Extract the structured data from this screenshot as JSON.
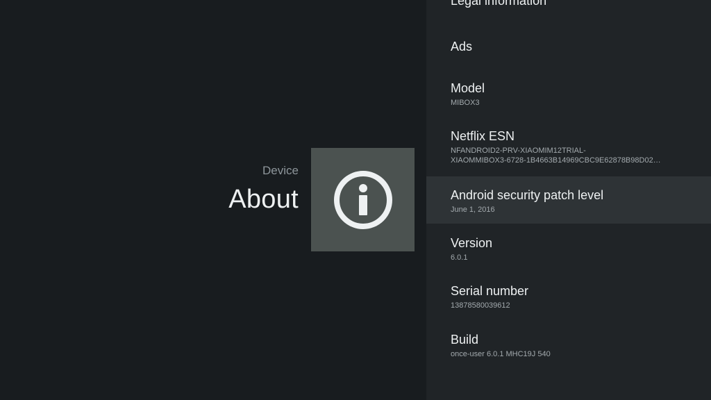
{
  "header": {
    "breadcrumb": "Device",
    "title": "About",
    "icon": "info-icon"
  },
  "items": [
    {
      "title": "Legal information",
      "summary": ""
    },
    {
      "title": "Ads",
      "summary": ""
    },
    {
      "title": "Model",
      "summary": "MIBOX3"
    },
    {
      "title": "Netflix ESN",
      "summary_line1": "NFANDROID2-PRV-XIAOMIM12TRIAL-",
      "summary_line2": "XIAOMMIBOX3-6728-1B4663B14969CBC9E62878B98D02…"
    },
    {
      "title": "Android security patch level",
      "summary": "June 1, 2016"
    },
    {
      "title": "Version",
      "summary": "6.0.1"
    },
    {
      "title": "Serial number",
      "summary": "13878580039612"
    },
    {
      "title": "Build",
      "summary": "once-user 6.0.1 MHC19J 540"
    }
  ],
  "colors": {
    "background": "#181c1f",
    "list_background": "#202427",
    "focused_background": "#2e3336",
    "icon_tile": "#4b5250"
  }
}
